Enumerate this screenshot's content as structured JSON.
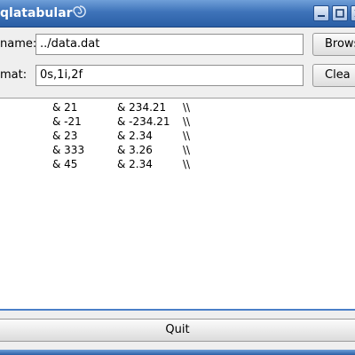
{
  "window": {
    "title": "qlatabular",
    "controls": [
      "minimize-icon",
      "maximize-icon",
      "close-icon"
    ],
    "accent_color": "#3e73b9"
  },
  "form": {
    "filename_label": "name:",
    "filename_value": "../data.dat",
    "format_label": "mat:",
    "format_value": "0s,1i,2f",
    "browse_label": "Brows",
    "clear_label": "Clea"
  },
  "output": {
    "rows": [
      {
        "c1": "& 21",
        "c2": "& 234.21",
        "c3": "\\\\"
      },
      {
        "c1": "& -21",
        "c2": "& -234.21",
        "c3": "\\\\"
      },
      {
        "c1": "& 23",
        "c2": "& 2.34",
        "c3": "\\\\"
      },
      {
        "c1": "& 333",
        "c2": "& 3.26",
        "c3": "\\\\"
      },
      {
        "c1": "& 45",
        "c2": "& 2.34",
        "c3": "\\\\"
      }
    ]
  },
  "footer": {
    "quit_label": "Quit"
  }
}
